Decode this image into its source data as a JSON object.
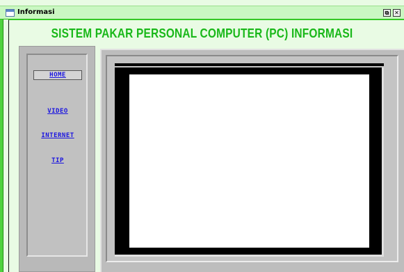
{
  "window": {
    "title": "Informasi",
    "restore_glyph": "⧉",
    "close_glyph": "✕"
  },
  "page": {
    "title": "SISTEM PAKAR PERSONAL COMPUTER (PC) INFORMASI"
  },
  "nav": {
    "items": [
      {
        "label": "HOME",
        "selected": true
      },
      {
        "label": "VIDEO",
        "selected": false
      },
      {
        "label": "INTERNET",
        "selected": false
      },
      {
        "label": "TIP",
        "selected": false
      }
    ]
  },
  "colors": {
    "title_green": "#19b819",
    "link_blue": "#1a14e0",
    "panel_gray": "#c1c1c1",
    "window_bg": "#e9fbe4"
  }
}
